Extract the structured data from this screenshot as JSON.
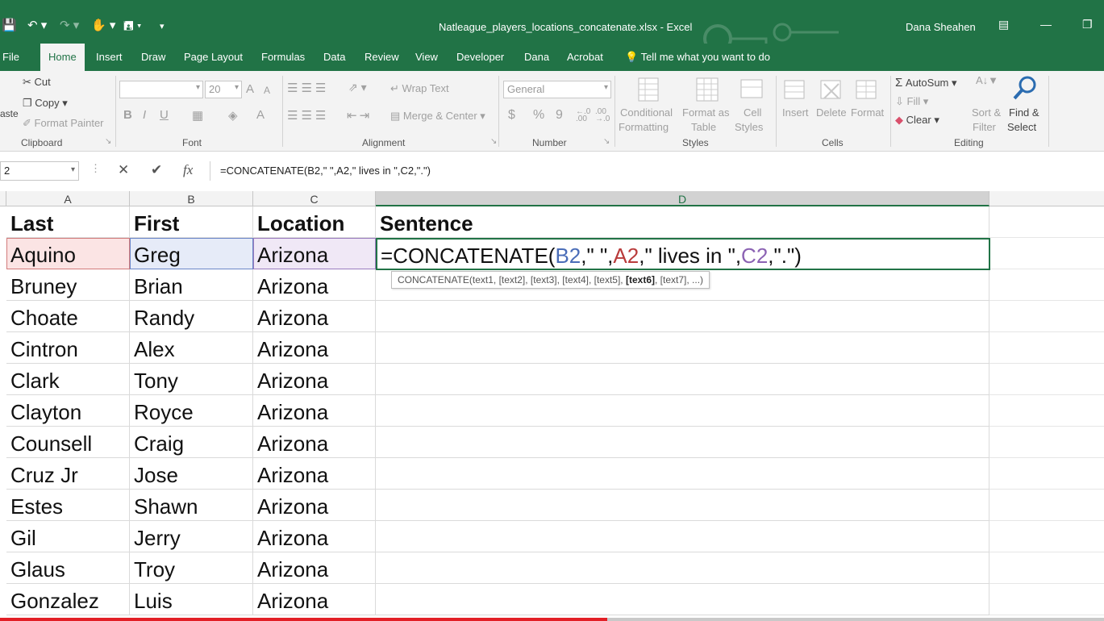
{
  "window": {
    "title": "Natleague_players_locations_concatenate.xlsx  -  Excel",
    "user": "Dana Sheahen"
  },
  "tabs": [
    "File",
    "Home",
    "Insert",
    "Draw",
    "Page Layout",
    "Formulas",
    "Data",
    "Review",
    "View",
    "Developer",
    "Dana",
    "Acrobat"
  ],
  "tell_me": "Tell me what you want to do",
  "ribbon": {
    "clipboard": {
      "paste": "aste",
      "cut": "Cut",
      "copy": "Copy",
      "format_painter": "Format Painter",
      "label": "Clipboard"
    },
    "font": {
      "size": "20",
      "bold": "B",
      "italic": "I",
      "underline": "U",
      "grow": "A",
      "shrink": "A",
      "label": "Font"
    },
    "alignment": {
      "wrap": "Wrap Text",
      "merge": "Merge & Center",
      "label": "Alignment"
    },
    "number": {
      "format": "General",
      "currency": "$",
      "percent": "%",
      "comma": "9",
      "inc": "←.0 .00",
      "dec": ".00 →.0",
      "label": "Number"
    },
    "styles": {
      "conditional_1": "Conditional",
      "conditional_2": "Formatting",
      "format_table_1": "Format as",
      "format_table_2": "Table",
      "cell_styles_1": "Cell",
      "cell_styles_2": "Styles",
      "label": "Styles"
    },
    "cells": {
      "insert": "Insert",
      "delete": "Delete",
      "format": "Format",
      "label": "Cells"
    },
    "editing": {
      "autosum": "AutoSum",
      "fill": "Fill",
      "clear": "Clear",
      "sort_1": "Sort &",
      "sort_2": "Filter",
      "find_1": "Find &",
      "find_2": "Select",
      "label": "Editing"
    }
  },
  "formula_bar": {
    "name_box": "2",
    "cancel": "✕",
    "enter": "✔",
    "fx": "fx",
    "formula": "=CONCATENATE(B2,\" \",A2,\" lives in \",C2,\".\")"
  },
  "columns": [
    "A",
    "B",
    "C",
    "D"
  ],
  "headers": {
    "a": "Last",
    "b": "First",
    "c": "Location",
    "d": "Sentence"
  },
  "rows": [
    {
      "last": "Aquino",
      "first": "Greg",
      "location": "Arizona"
    },
    {
      "last": "Bruney",
      "first": "Brian",
      "location": "Arizona"
    },
    {
      "last": "Choate",
      "first": "Randy",
      "location": "Arizona"
    },
    {
      "last": "Cintron",
      "first": "Alex",
      "location": "Arizona"
    },
    {
      "last": "Clark",
      "first": "Tony",
      "location": "Arizona"
    },
    {
      "last": "Clayton",
      "first": "Royce",
      "location": "Arizona"
    },
    {
      "last": "Counsell",
      "first": "Craig",
      "location": "Arizona"
    },
    {
      "last": "Cruz Jr",
      "first": "Jose",
      "location": "Arizona"
    },
    {
      "last": "Estes",
      "first": "Shawn",
      "location": "Arizona"
    },
    {
      "last": "Gil",
      "first": "Jerry",
      "location": "Arizona"
    },
    {
      "last": "Glaus",
      "first": "Troy",
      "location": "Arizona"
    },
    {
      "last": "Gonzalez",
      "first": "Luis",
      "location": "Arizona"
    }
  ],
  "active_cell": {
    "p1": "=CONCATENATE(",
    "ref_b": "B2",
    "p2": ",\" \",",
    "ref_a": "A2",
    "p3": ",\" lives in \",",
    "ref_c": "C2",
    "p4": ",\".\")"
  },
  "tooltip": {
    "pre": "CONCATENATE(text1, [text2], [text3], [text4], [text5], ",
    "bold": "[text6]",
    "post": ", [text7], ...)"
  },
  "video_progress": 0.55,
  "colors": {
    "excel_green": "#217346",
    "ref_b": "#4a6db8",
    "ref_a": "#b93b3b",
    "ref_c": "#8b62b3",
    "progress": "#e21f26"
  }
}
